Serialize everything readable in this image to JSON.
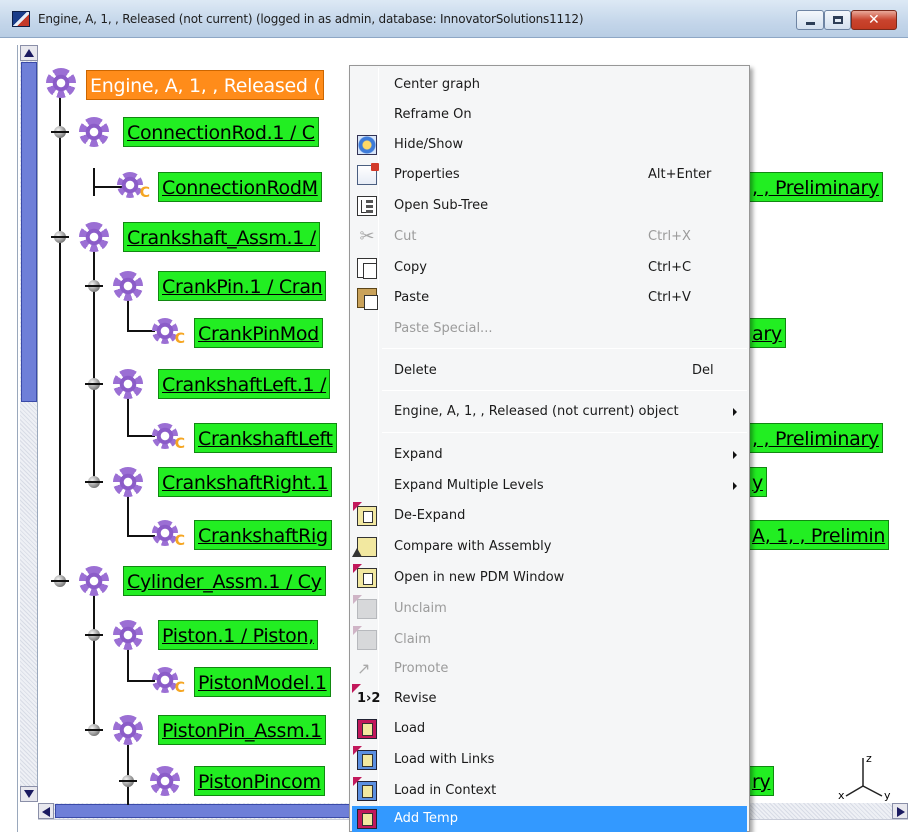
{
  "window": {
    "title": "Engine, A, 1, , Released (not current) (logged in as admin, database: InnovatorSolutions1112)",
    "minimize_icon": "minimize-icon",
    "maximize_icon": "maximize-icon",
    "close_icon": "close-icon",
    "close_glyph": "✕"
  },
  "tree": {
    "root": {
      "label": "Engine, A, 1, , Released ("
    },
    "nodes": [
      {
        "label": "ConnectionRod.1 / C",
        "tail": ""
      },
      {
        "label": "ConnectionRodM",
        "tail": ", , Preliminary"
      },
      {
        "label": "Crankshaft_Assm.1 /",
        "tail": ""
      },
      {
        "label": "CrankPin.1 / Cran",
        "tail": ""
      },
      {
        "label": "CrankPinMod",
        "tail": "ary"
      },
      {
        "label": "CrankshaftLeft.1 /",
        "tail": ""
      },
      {
        "label": "CrankshaftLeft",
        "tail": ", , Preliminary"
      },
      {
        "label": "CrankshaftRight.1",
        "tail": "y"
      },
      {
        "label": "CrankshaftRig",
        "tail": "A, 1, , Prelimin"
      },
      {
        "label": "Cylinder_Assm.1 / Cy",
        "tail": ""
      },
      {
        "label": "Piston.1 / Piston,",
        "tail": ""
      },
      {
        "label": "PistonModel.1",
        "tail": ""
      },
      {
        "label": "PistonPin_Assm.1",
        "tail": ""
      },
      {
        "label": "PistonPincom",
        "tail": "ry"
      }
    ],
    "component_marker": "C"
  },
  "axis": {
    "x": "x",
    "y": "y",
    "z": "z"
  },
  "context_menu": {
    "items": [
      {
        "label": "Center graph",
        "accel": ""
      },
      {
        "label": "Reframe On",
        "accel": ""
      },
      {
        "label": "Hide/Show",
        "accel": ""
      },
      {
        "label": "Properties",
        "accel": "Alt+Enter"
      },
      {
        "label": "Open Sub-Tree",
        "accel": ""
      },
      {
        "label": "Cut",
        "accel": "Ctrl+X"
      },
      {
        "label": "Copy",
        "accel": "Ctrl+C"
      },
      {
        "label": "Paste",
        "accel": "Ctrl+V"
      },
      {
        "label": "Paste Special...",
        "accel": ""
      },
      {
        "label": "Delete",
        "accel": "Del"
      },
      {
        "label": "Engine, A, 1, , Released (not current) object",
        "accel": ""
      },
      {
        "label": "Expand",
        "accel": ""
      },
      {
        "label": "Expand Multiple Levels",
        "accel": ""
      },
      {
        "label": "De-Expand",
        "accel": ""
      },
      {
        "label": "Compare with Assembly",
        "accel": ""
      },
      {
        "label": "Open in new PDM Window",
        "accel": ""
      },
      {
        "label": "Unclaim",
        "accel": ""
      },
      {
        "label": "Claim",
        "accel": ""
      },
      {
        "label": "Promote",
        "accel": ""
      },
      {
        "label": "Revise",
        "accel": ""
      },
      {
        "label": "Load",
        "accel": ""
      },
      {
        "label": "Load with Links",
        "accel": ""
      },
      {
        "label": "Load in Context",
        "accel": ""
      },
      {
        "label": "Add Temp",
        "accel": ""
      }
    ],
    "icons": {
      "cut_glyph": "✂",
      "revise_glyph": "1›2",
      "promote_glyph": "↗"
    },
    "colors": {
      "highlight": "#3399ff"
    }
  },
  "colors": {
    "root_node": "#ff8c1a",
    "node": "#22ee22",
    "gear": "#9b6fd4",
    "component_marker": "#f5a623"
  }
}
